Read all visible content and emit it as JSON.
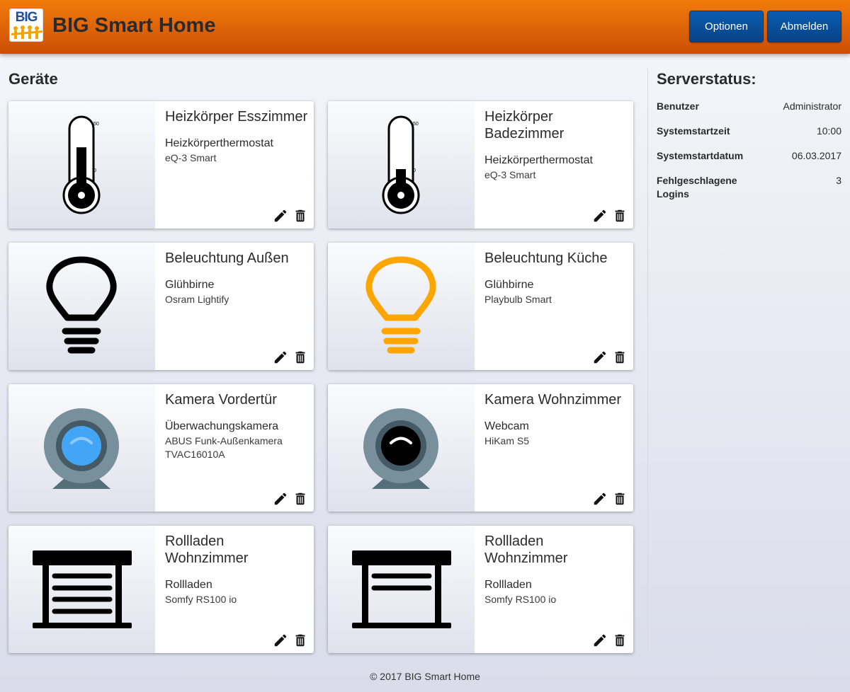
{
  "header": {
    "logo_text": "BIG",
    "app_title": "BIG Smart Home",
    "options_label": "Optionen",
    "logout_label": "Abmelden"
  },
  "devices_section": {
    "title": "Geräte"
  },
  "devices": [
    {
      "name": "Heizkörper Esszimmer",
      "type": "Heizkörperthermostat",
      "model": "eQ-3 Smart",
      "icon": "thermometer-icon",
      "level_percent": 60,
      "scale_max": "50",
      "scale_min": "0"
    },
    {
      "name": "Heizkörper Badezimmer",
      "type": "Heizkörperthermostat",
      "model": "eQ-3 Smart",
      "icon": "thermometer-icon",
      "level_percent": 25,
      "scale_max": "50",
      "scale_min": "0"
    },
    {
      "name": "Beleuchtung Außen",
      "type": "Glühbirne",
      "model": "Osram Lightify",
      "icon": "lightbulb-off-icon",
      "color": "#000000"
    },
    {
      "name": "Beleuchtung Küche",
      "type": "Glühbirne",
      "model": "Playbulb Smart",
      "icon": "lightbulb-on-icon",
      "color": "#ffa500"
    },
    {
      "name": "Kamera Vordertür",
      "type": "Überwachungskamera",
      "model": "ABUS Funk-Außenkamera TVAC16010A",
      "icon": "webcam-icon",
      "color": "#42a5f5"
    },
    {
      "name": "Kamera Wohnzimmer",
      "type": "Webcam",
      "model": "HiKam S5",
      "icon": "webcam-icon",
      "color": "#000000"
    },
    {
      "name": "Rollladen Wohnzimmer",
      "type": "Rollladen",
      "model": "Somfy RS100 io",
      "icon": "shutter-closed-icon",
      "state": "closed"
    },
    {
      "name": "Rollladen Wohnzimmer",
      "type": "Rollladen",
      "model": "Somfy RS100 io",
      "icon": "shutter-open-icon",
      "state": "open"
    }
  ],
  "server_status": {
    "title": "Serverstatus:",
    "rows": [
      {
        "label": "Benutzer",
        "value": "Administrator"
      },
      {
        "label": "Systemstartzeit",
        "value": "10:00"
      },
      {
        "label": "Systemstartdatum",
        "value": "06.03.2017"
      },
      {
        "label": "Fehlgeschlagene Logins",
        "value": "3"
      }
    ]
  },
  "footer": {
    "text": "© 2017 BIG Smart Home"
  },
  "colors": {
    "header": "#e8690a",
    "button": "#0a56a6",
    "lamp_on": "#ffa500",
    "camera_lens": "#42a5f5"
  }
}
